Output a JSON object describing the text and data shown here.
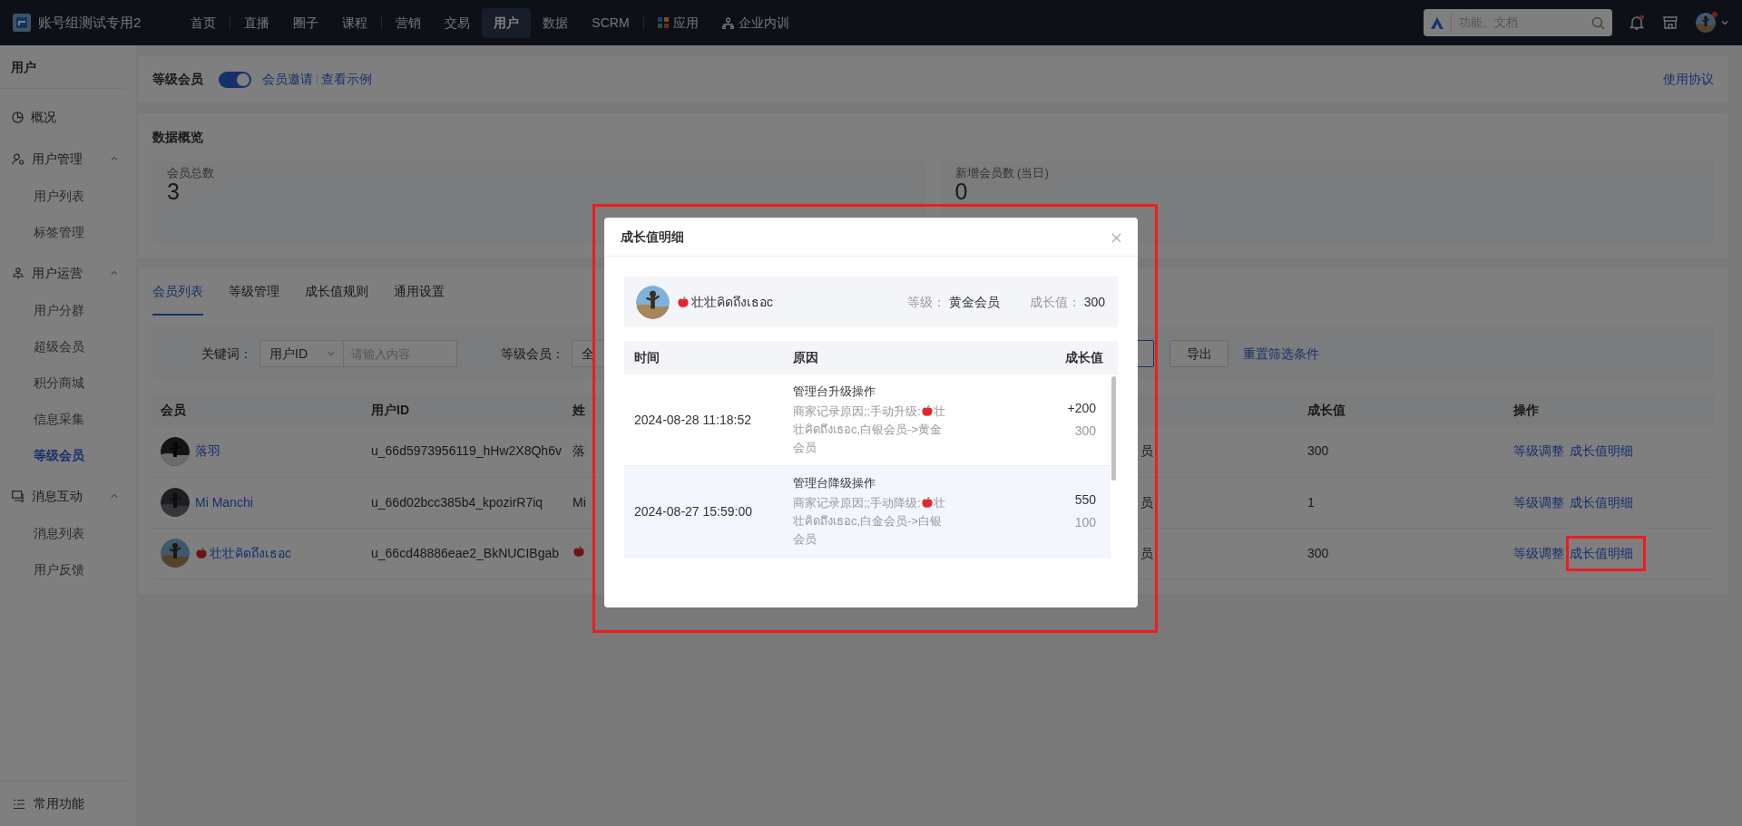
{
  "topbar": {
    "brand": "账号组测试专用2",
    "nav": [
      {
        "label": "首页",
        "kind": "plain",
        "selected": false,
        "separator_after": true
      },
      {
        "label": "直播",
        "kind": "plain",
        "selected": false,
        "separator_after": false
      },
      {
        "label": "圈子",
        "kind": "plain",
        "selected": false,
        "separator_after": false
      },
      {
        "label": "课程",
        "kind": "plain",
        "selected": false,
        "separator_after": true
      },
      {
        "label": "营销",
        "kind": "plain",
        "selected": false,
        "separator_after": false
      },
      {
        "label": "交易",
        "kind": "plain",
        "selected": false,
        "separator_after": false
      },
      {
        "label": "用户",
        "kind": "plain",
        "selected": true,
        "separator_after": false
      },
      {
        "label": "数据",
        "kind": "plain",
        "selected": false,
        "separator_after": false
      },
      {
        "label": "SCRM",
        "kind": "plain",
        "selected": false,
        "separator_after": true
      },
      {
        "label": "应用",
        "kind": "apps",
        "selected": false,
        "separator_after": false
      },
      {
        "label": "企业内训",
        "kind": "training",
        "selected": false,
        "separator_after": false
      }
    ],
    "search": {
      "placeholder": "功能、文档"
    },
    "notifications_unread": true,
    "profile_unread": true
  },
  "sidebar": {
    "title": "用户",
    "items": [
      {
        "label": "概况",
        "selected": false
      },
      {
        "label": "用户管理",
        "expanded": true,
        "children": [
          {
            "label": "用户列表",
            "selected": false
          },
          {
            "label": "标签管理",
            "selected": false
          }
        ]
      },
      {
        "label": "用户运营",
        "expanded": true,
        "children": [
          {
            "label": "用户分群",
            "selected": false
          },
          {
            "label": "超级会员",
            "selected": false
          },
          {
            "label": "积分商城",
            "selected": false
          },
          {
            "label": "信息采集",
            "selected": false
          },
          {
            "label": "等级会员",
            "selected": true
          }
        ]
      },
      {
        "label": "消息互动",
        "expanded": true,
        "children": [
          {
            "label": "消息列表",
            "selected": false
          },
          {
            "label": "用户反馈",
            "selected": false
          }
        ]
      }
    ],
    "footer": "常用功能"
  },
  "header": {
    "title": "等级会员",
    "enabled": true,
    "links": [
      "会员邀请",
      "查看示例"
    ],
    "agreement_link": "使用协议"
  },
  "overview": {
    "title": "数据概览",
    "stats": [
      {
        "label": "会员总数",
        "value": "3"
      },
      {
        "label": "新增会员数 (当日)",
        "value": "0"
      }
    ]
  },
  "tabs": [
    {
      "label": "会员列表",
      "selected": true
    },
    {
      "label": "等级管理",
      "selected": false
    },
    {
      "label": "成长值规则",
      "selected": false
    },
    {
      "label": "通用设置",
      "selected": false
    }
  ],
  "filters": {
    "keyword_label": "关键词：",
    "keyword_type": "用户ID",
    "keyword_placeholder": "请输入内容",
    "level_label": "等级会员：",
    "level_value": "全",
    "export_button": "导出",
    "reset_link": "重置筛选条件"
  },
  "members": {
    "columns": {
      "member": "会员",
      "user_id": "用户ID",
      "name": "姓",
      "growth": "成长值",
      "actions": "操作"
    },
    "rows": [
      {
        "member": [
          {
            "kind": "text",
            "text": "落羽"
          }
        ],
        "user_id": "u_66d5973956119_hHw2X8Qh6v",
        "name": [
          {
            "kind": "text",
            "text": "落"
          }
        ],
        "column_4": "员",
        "growth": "300",
        "actions": [
          {
            "label": "等级调整",
            "highlighted": false
          },
          {
            "label": "成长值明细",
            "highlighted": false
          }
        ]
      },
      {
        "member": [
          {
            "kind": "text",
            "text": "Mi Manchi"
          }
        ],
        "user_id": "u_66d02bcc385b4_kpozirR7iq",
        "name": [
          {
            "kind": "text",
            "text": "Mi"
          }
        ],
        "column_4": "员",
        "growth": "1",
        "actions": [
          {
            "label": "等级调整",
            "highlighted": false
          },
          {
            "label": "成长值明细",
            "highlighted": false
          }
        ]
      },
      {
        "member": [
          {
            "kind": "apple"
          },
          {
            "kind": "text",
            "text": "壮壮คิดถึงเธอc"
          }
        ],
        "user_id": "u_66cd48886eae2_BkNUCIBgab",
        "name": [
          {
            "kind": "apple"
          }
        ],
        "column_4": "员",
        "growth": "300",
        "actions": [
          {
            "label": "等级调整",
            "highlighted": false
          },
          {
            "label": "成长值明细",
            "highlighted": true
          }
        ]
      }
    ]
  },
  "dialog": {
    "title": "成长值明细",
    "highlighted": true,
    "member": {
      "name": [
        {
          "kind": "apple"
        },
        {
          "kind": "text",
          "text": "壮壮คิดถึงเธอc"
        }
      ],
      "level_label": "等级：",
      "level": "黄金会员",
      "growth_label": "成长值：",
      "growth": "300"
    },
    "columns": [
      "时间",
      "原因",
      "成长值"
    ],
    "records": [
      {
        "time": "2024-08-28 11:18:52",
        "title": "管理台升级操作",
        "note": [
          {
            "kind": "text",
            "text": "商家记录原因;;手动升级:"
          },
          {
            "kind": "apple"
          },
          {
            "kind": "text",
            "text": "壮壮คิดถึงเธอc,白银会员->黄金会员"
          }
        ],
        "change": "+200",
        "total": "300",
        "hovered": false
      },
      {
        "time": "2024-08-27 15:59:00",
        "title": "管理台降级操作",
        "note": [
          {
            "kind": "text",
            "text": "商家记录原因;;手动降级:"
          },
          {
            "kind": "apple"
          },
          {
            "kind": "text",
            "text": "壮壮คิดถึงเธอc,白金会员->白银会员"
          }
        ],
        "change": "550",
        "total": "100",
        "hovered": true
      }
    ]
  }
}
